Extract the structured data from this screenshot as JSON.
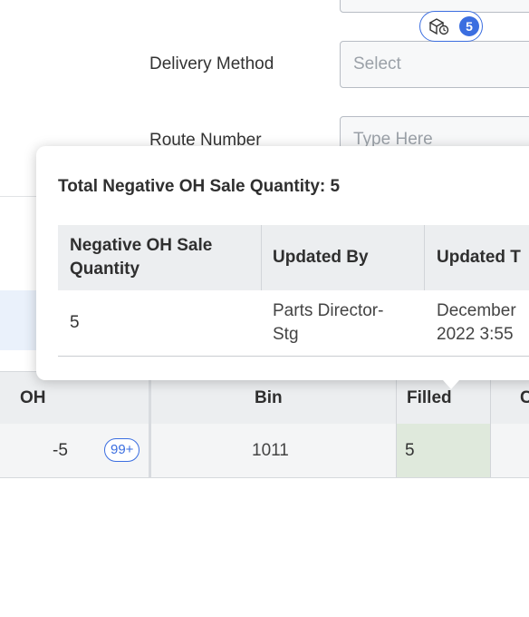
{
  "form": {
    "delivery_method_label": "Delivery Method",
    "delivery_method_placeholder": "Select",
    "route_number_label": "Route Number",
    "route_number_placeholder": "Type Here"
  },
  "grid": {
    "columns": [
      "OH",
      "Bin",
      "Filled",
      "C"
    ],
    "row": {
      "oh": "-5",
      "oh_badge": "99+",
      "bin": "1011",
      "filled": "5",
      "filled_icon": "package-icon",
      "filled_count": "5"
    }
  },
  "popover": {
    "title": "Total Negative OH Sale Quantity: 5",
    "headers": [
      "Negative OH Sale Quantity",
      "Updated By",
      "Updated T"
    ],
    "header_lines": [
      [
        "Negative OH Sale",
        "Quantity"
      ],
      [
        "Updated By"
      ],
      [
        "Updated T"
      ]
    ],
    "row": {
      "quantity": "5",
      "updated_by_lines": [
        "Parts Director-",
        "Stg"
      ],
      "updated_time_lines": [
        "December",
        "2022 3:55"
      ]
    }
  },
  "colors": {
    "accent": "#3b6ee0",
    "filled_bg": "#dfe9dc",
    "header_bg": "#eceef0"
  }
}
